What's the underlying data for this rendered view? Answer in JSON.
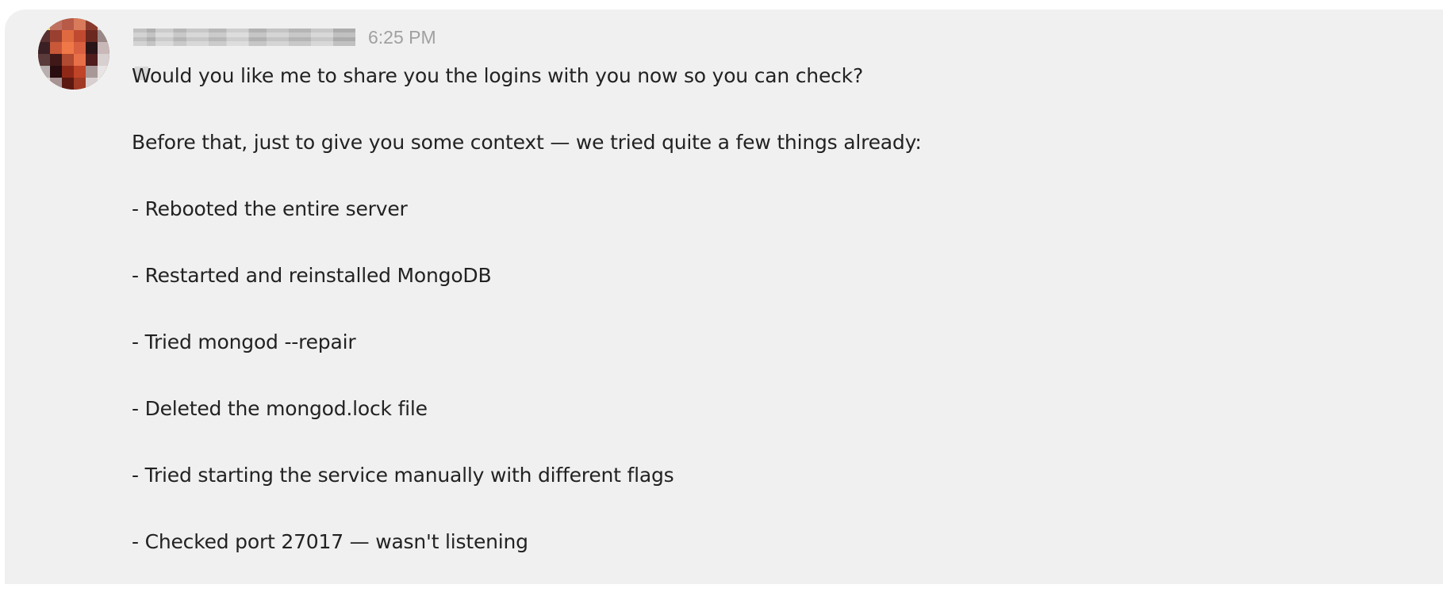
{
  "message": {
    "sender_name": "",
    "timestamp": "6:25 PM",
    "lines": [
      "Would you like me to share you the logins with you now so you can check?",
      "Before that, just to give you some context — we tried quite a few things already:",
      "- Rebooted the entire server",
      "- Restarted and reinstalled MongoDB",
      "- Tried mongod --repair",
      "- Deleted the mongod.lock file",
      "- Tried starting the service manually with different flags",
      "- Checked port 27017 — wasn't listening"
    ]
  },
  "colors": {
    "message_background": "#f0f0f0",
    "text": "#222222",
    "timestamp": "#a0a0a0"
  }
}
